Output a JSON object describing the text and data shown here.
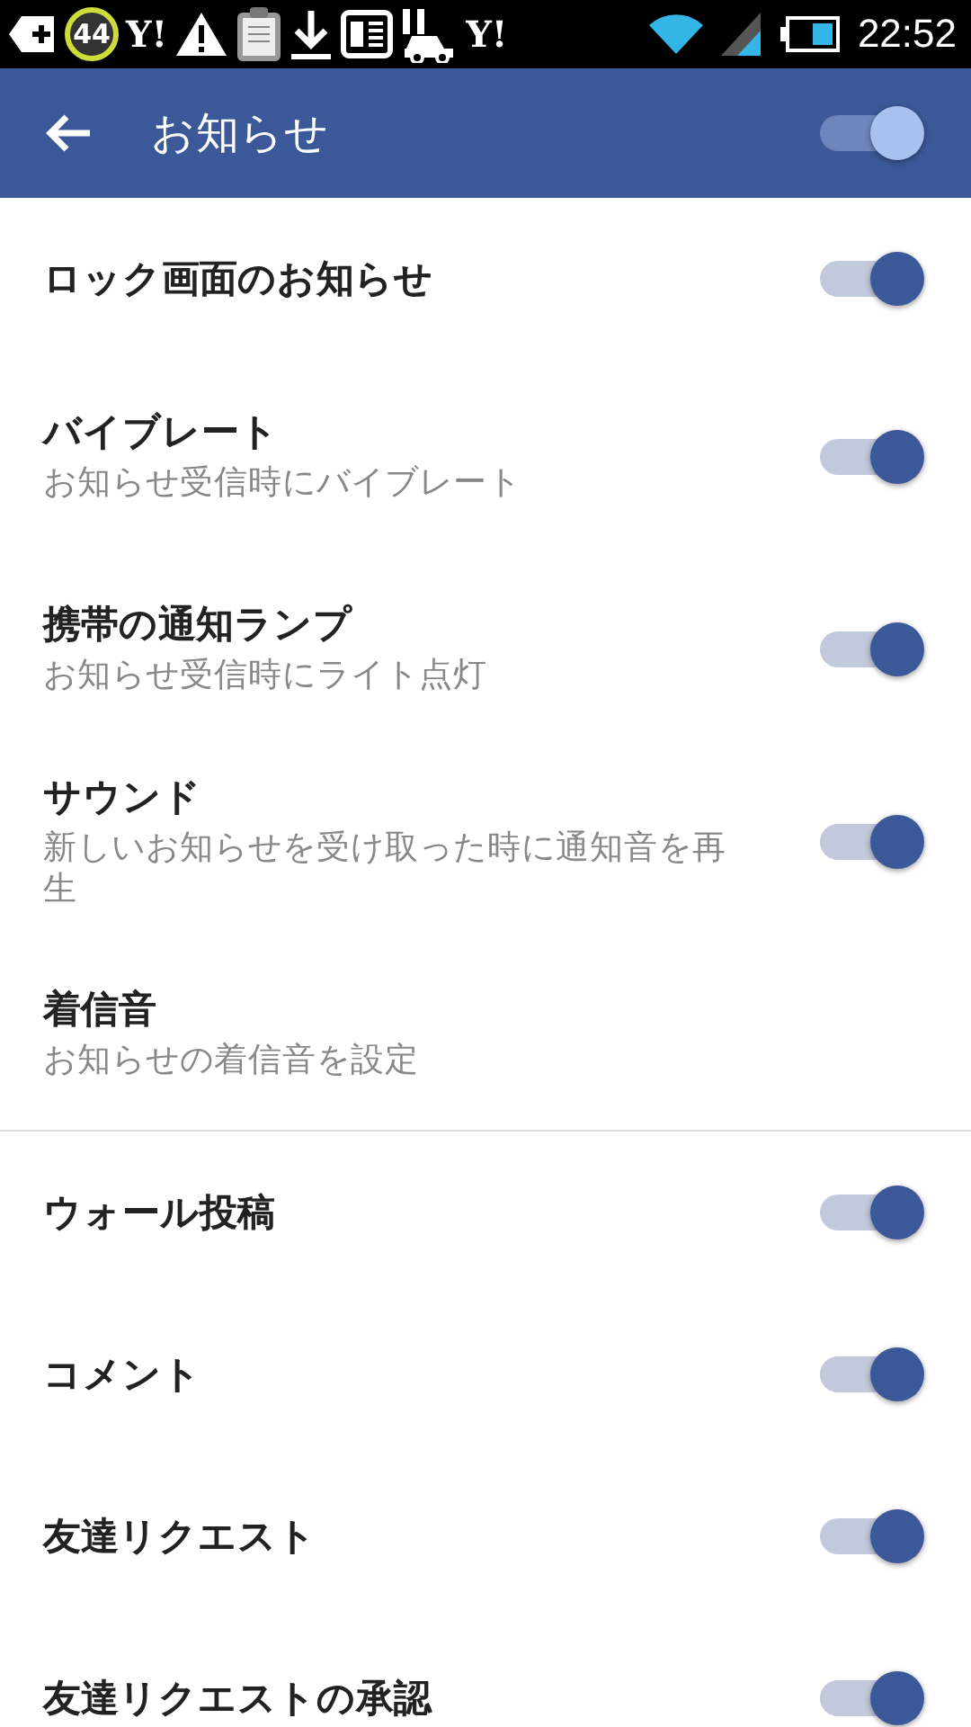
{
  "status_bar": {
    "badge": "44",
    "logos": [
      "Y!",
      "Y!"
    ],
    "time": "22:52"
  },
  "app_bar": {
    "title": "お知らせ",
    "master_on": true
  },
  "sections": [
    {
      "items": [
        {
          "kind": "toggle",
          "title": "ロック画面のお知らせ",
          "on": true
        },
        {
          "kind": "toggle",
          "title": "バイブレート",
          "subtitle": "お知らせ受信時にバイブレート",
          "on": true
        },
        {
          "kind": "toggle",
          "title": "携帯の通知ランプ",
          "subtitle": "お知らせ受信時にライト点灯",
          "on": true
        },
        {
          "kind": "toggle",
          "title": "サウンド",
          "subtitle": "新しいお知らせを受け取った時に通知音を再生",
          "on": true
        },
        {
          "kind": "plain",
          "title": "着信音",
          "subtitle": "お知らせの着信音を設定"
        }
      ]
    },
    {
      "items": [
        {
          "kind": "toggle",
          "title": "ウォール投稿",
          "on": true
        },
        {
          "kind": "toggle",
          "title": "コメント",
          "on": true
        },
        {
          "kind": "toggle",
          "title": "友達リクエスト",
          "on": true
        },
        {
          "kind": "toggle",
          "title": "友達リクエストの承認",
          "on": true
        }
      ]
    }
  ]
}
